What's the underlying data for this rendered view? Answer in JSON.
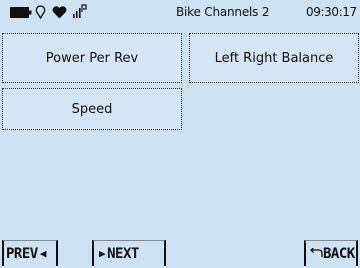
{
  "status": {
    "title": "Bike Channels 2",
    "time": "09:30:17",
    "icons": [
      "battery-icon",
      "location-pin-icon",
      "heart-icon",
      "signal-bars-icon"
    ]
  },
  "tiles": [
    {
      "label": "Power Per Rev"
    },
    {
      "label": "Left Right Balance"
    },
    {
      "label": "Speed"
    }
  ],
  "footer": {
    "prev_label": "PREV",
    "next_label": "NEXT",
    "back_label": "BACK"
  }
}
